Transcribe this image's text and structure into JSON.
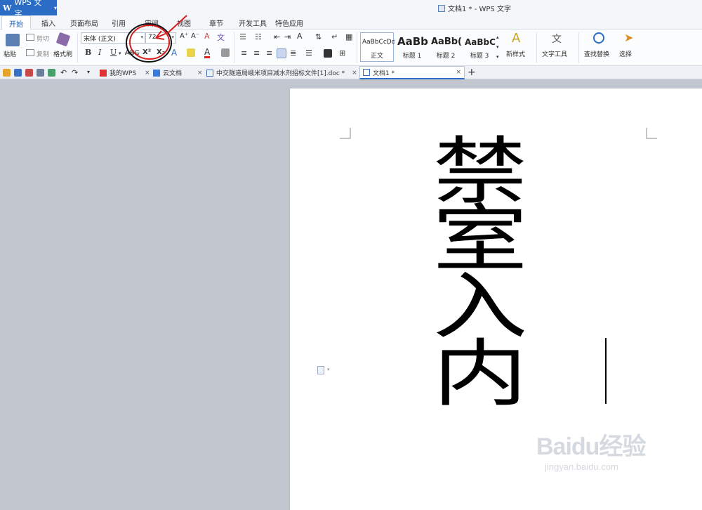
{
  "app": {
    "name": "WPS 文字",
    "window_title": "文档1 * - WPS 文字"
  },
  "ribbon_tabs": [
    "开始",
    "插入",
    "页面布局",
    "引用",
    "审阅",
    "视图",
    "章节",
    "开发工具",
    "特色应用"
  ],
  "ribbon": {
    "paste": "粘贴",
    "cut": "剪切",
    "copy": "复制",
    "format_painter": "格式刷",
    "font_name": "宋体 (正文)",
    "font_size": "72",
    "bold": "B",
    "italic": "I",
    "underline": "U",
    "superscript": "X²",
    "subscript": "X₂",
    "styles": [
      {
        "sample": "AaBbCcDd",
        "name": "正文"
      },
      {
        "sample": "AaBb",
        "name": "标题 1"
      },
      {
        "sample": "AaBb(",
        "name": "标题 2"
      },
      {
        "sample": "AaBbC",
        "name": "标题 3"
      }
    ],
    "new_style": "新样式",
    "text_tools": "文字工具",
    "find_replace": "查找替换",
    "select": "选择"
  },
  "doc_tabs": [
    {
      "label": "我的WPS"
    },
    {
      "label": "云文档"
    },
    {
      "label": "中交隧道局峨米项目减水剂招标文件[1].doc *"
    },
    {
      "label": "文档1 *"
    }
  ],
  "document": {
    "chars": [
      "禁",
      "室",
      "入",
      "内"
    ]
  },
  "watermark": {
    "brand": "Baidu经验",
    "url": "jingyan.baidu.com"
  }
}
